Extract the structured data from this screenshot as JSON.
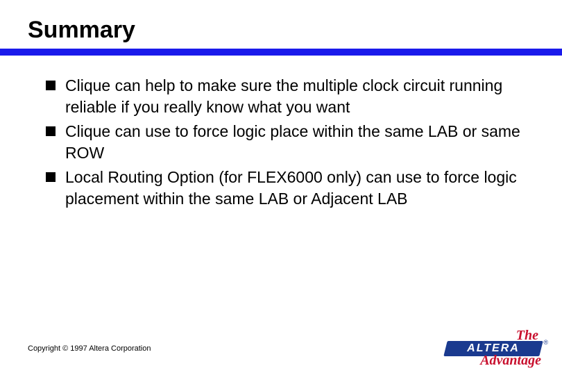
{
  "title": "Summary",
  "bullets": [
    "Clique can help to make sure the multiple clock circuit running reliable if you really know what you want",
    "Clique can use to force logic place within the same LAB or same ROW",
    "Local Routing Option (for FLEX6000 only) can use to force logic placement within the same LAB or Adjacent LAB"
  ],
  "copyright": "Copyright © 1997 Altera Corporation",
  "logo": {
    "top": "The",
    "brand": "ALTERA",
    "bottom": "Advantage",
    "reg": "®"
  }
}
